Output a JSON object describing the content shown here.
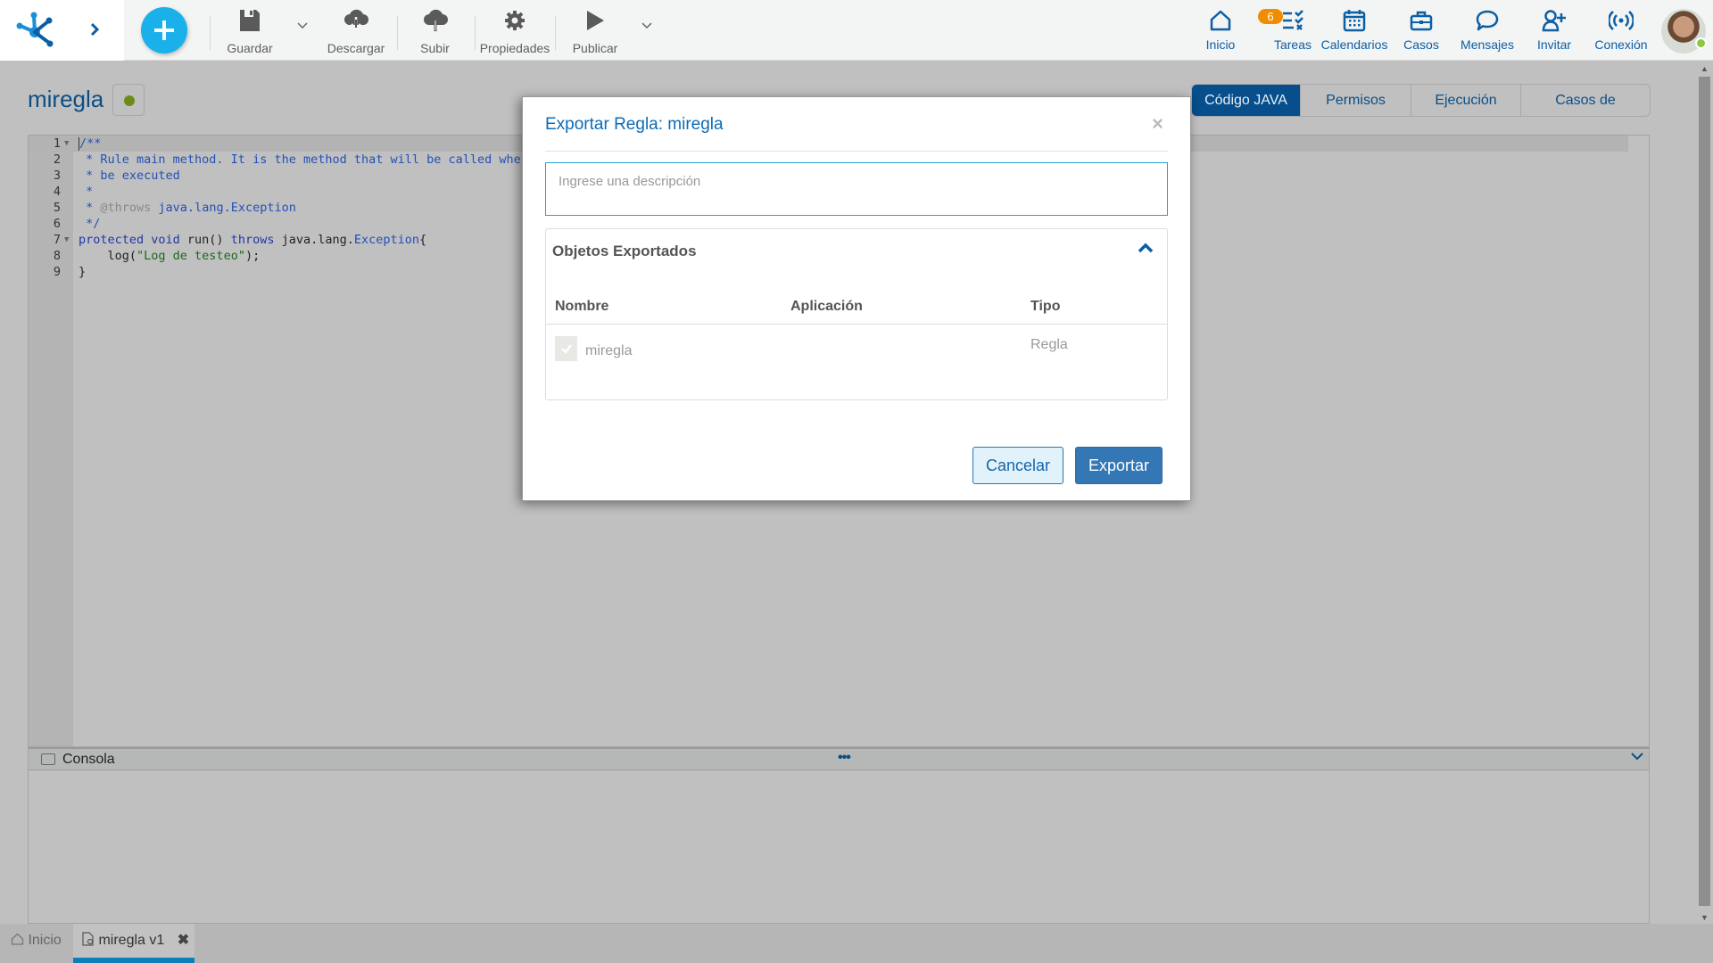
{
  "toolbar": {
    "expand_icon": "chevron-right",
    "add_icon": "plus",
    "save_label": "Guardar",
    "download_label": "Descargar",
    "upload_label": "Subir",
    "properties_label": "Propiedades",
    "publish_label": "Publicar"
  },
  "nav": {
    "home_label": "Inicio",
    "tasks_label": "Tareas",
    "tasks_badge": "6",
    "calendars_label": "Calendarios",
    "cases_label": "Casos",
    "messages_label": "Mensajes",
    "invite_label": "Invitar",
    "connection_label": "Conexión"
  },
  "page": {
    "title": "miregla",
    "status_color": "#6b8c1a"
  },
  "tabs": [
    {
      "label": "Código JAVA",
      "active": true
    },
    {
      "label": "Permisos",
      "active": false
    },
    {
      "label": "Ejecución",
      "active": false
    },
    {
      "label": "Casos de prueba",
      "active": false
    }
  ],
  "editor": {
    "lines": [
      {
        "n": "1",
        "fold": true,
        "parts": [
          {
            "t": "/**",
            "c": "com"
          }
        ]
      },
      {
        "n": "2",
        "parts": [
          {
            "t": " * Rule main method. It is the method that will be called when the rule needs to",
            "c": "com"
          }
        ]
      },
      {
        "n": "3",
        "parts": [
          {
            "t": " * be executed",
            "c": "com"
          }
        ]
      },
      {
        "n": "4",
        "parts": [
          {
            "t": " *",
            "c": "com"
          }
        ]
      },
      {
        "n": "5",
        "parts": [
          {
            "t": " * ",
            "c": "com"
          },
          {
            "t": "@throws",
            "c": "doc"
          },
          {
            "t": " java.lang.Exception",
            "c": "com"
          }
        ]
      },
      {
        "n": "6",
        "parts": [
          {
            "t": " */",
            "c": "com"
          }
        ]
      },
      {
        "n": "7",
        "fold": true,
        "parts": [
          {
            "t": "protected void ",
            "c": "kw"
          },
          {
            "t": "run() ",
            "c": "pl"
          },
          {
            "t": "throws",
            "c": "kw"
          },
          {
            "t": " java.lang.",
            "c": "pl"
          },
          {
            "t": "Exception",
            "c": "kw2"
          },
          {
            "t": "{",
            "c": "pl"
          }
        ]
      },
      {
        "n": "8",
        "parts": [
          {
            "t": "    log(",
            "c": "pl"
          },
          {
            "t": "\"Log de testeo\"",
            "c": "str"
          },
          {
            "t": ");",
            "c": "pl"
          }
        ]
      },
      {
        "n": "9",
        "parts": [
          {
            "t": "}",
            "c": "pl"
          }
        ]
      }
    ]
  },
  "console": {
    "label": "Consola",
    "dots": "•••"
  },
  "bottom_tabs": {
    "home_label": "Inicio",
    "active_label": "miregla v1"
  },
  "modal": {
    "title": "Exportar Regla: miregla",
    "close_glyph": "×",
    "description_placeholder": "Ingrese una descripción",
    "description_value": "",
    "panel_title": "Objetos Exportados",
    "columns": [
      "Nombre",
      "Aplicación",
      "Tipo"
    ],
    "rows": [
      {
        "checked": true,
        "nombre": "miregla",
        "aplicacion": "",
        "tipo": "Regla"
      }
    ],
    "cancel_label": "Cancelar",
    "export_label": "Exportar"
  },
  "colors": {
    "accent": "#0b6cb5",
    "active_tab": "#064f8c",
    "add_button": "#1ab0ea",
    "badge": "#f08c00",
    "online": "#8dc63f"
  }
}
